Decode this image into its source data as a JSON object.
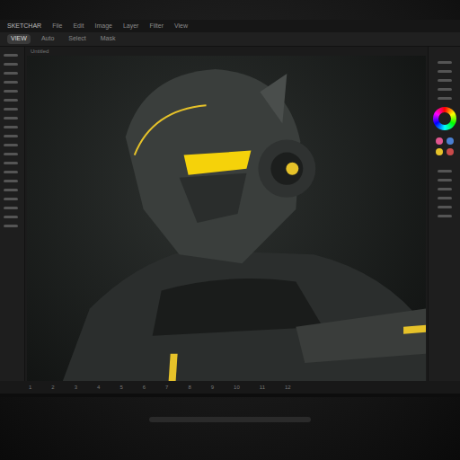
{
  "app": {
    "title": "SKETCHAR"
  },
  "menu": [
    {
      "label": "File",
      "selected": false
    },
    {
      "label": "Edit",
      "selected": false
    },
    {
      "label": "Image",
      "selected": false
    },
    {
      "label": "Layer",
      "selected": false
    },
    {
      "label": "Filter",
      "selected": false
    },
    {
      "label": "View",
      "selected": false
    }
  ],
  "toolbar": [
    {
      "label": "VIEW",
      "selected": true
    },
    {
      "label": "Auto",
      "selected": false
    },
    {
      "label": "Select",
      "selected": false
    },
    {
      "label": "Mask",
      "selected": false
    }
  ],
  "canvas_tab": "Untitled",
  "swatches": [
    {
      "color": "#e0568f"
    },
    {
      "color": "#4a7fd1"
    },
    {
      "color": "#e6c229"
    },
    {
      "color": "#c94a4a"
    }
  ],
  "timeline": [
    "1",
    "2",
    "3",
    "4",
    "5",
    "6",
    "7",
    "8",
    "9",
    "10",
    "11",
    "12"
  ]
}
